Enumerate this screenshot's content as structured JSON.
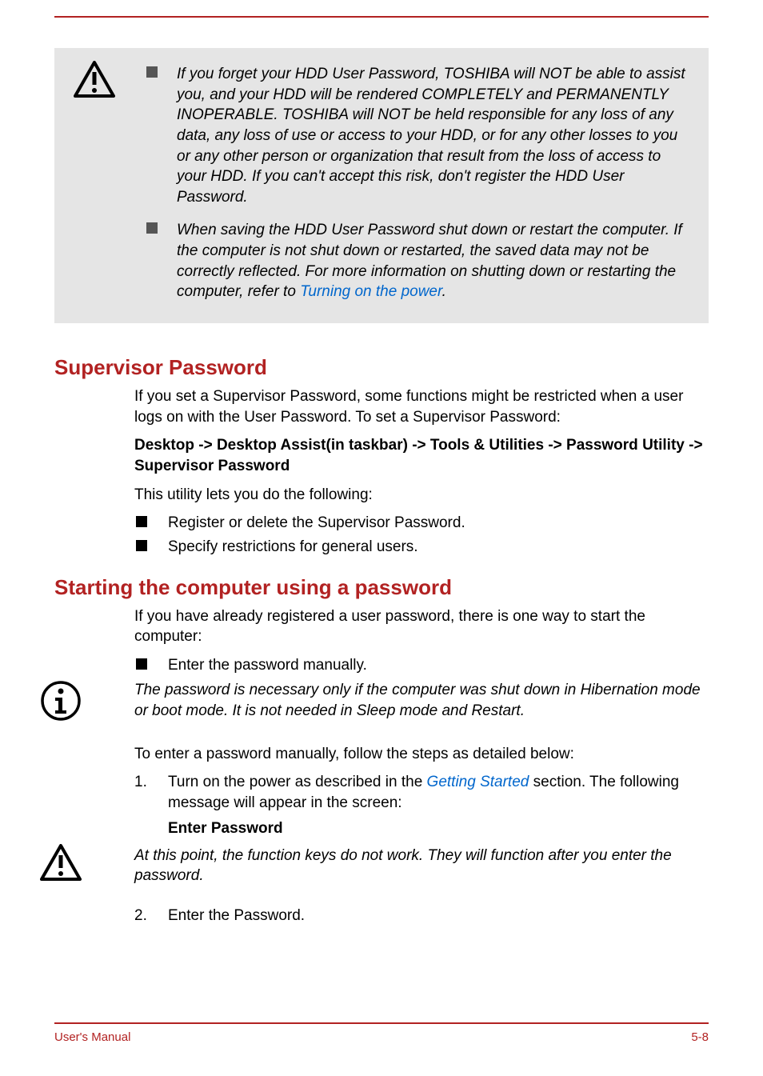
{
  "warning": {
    "items": [
      {
        "text": "If you forget your HDD User Password, TOSHIBA will NOT be able to assist you, and your HDD will be rendered COMPLETELY and PERMANENTLY INOPERABLE. TOSHIBA will NOT be held responsible for any loss of any data, any loss of use or access to your HDD, or for any other losses to you or any other person or organization that result from the loss of access to your HDD. If you can't accept this risk, don't register the HDD User Password."
      },
      {
        "text_before_link": "When saving the HDD User Password shut down or restart the computer. If the computer is not shut down or restarted, the saved data may not be correctly reflected. For more information on shutting down or restarting the computer, refer to ",
        "link": "Turning on the power",
        "text_after_link": "."
      }
    ]
  },
  "section1": {
    "heading": "Supervisor Password",
    "p1": "If you set a Supervisor Password, some functions might be restricted when a user logs on with the User Password. To set a Supervisor Password:",
    "path": "Desktop -> Desktop Assist(in taskbar) -> Tools & Utilities -> Password Utility -> Supervisor Password",
    "p2": "This utility lets you do the following:",
    "bullets": [
      "Register or delete the Supervisor Password.",
      "Specify restrictions for general users."
    ]
  },
  "section2": {
    "heading": "Starting the computer using a password",
    "p1": "If you have already registered a user password, there is one way to start the computer:",
    "bullets": [
      "Enter the password manually."
    ],
    "info_note": "The password is necessary only if the computer was shut down in Hibernation mode or boot mode. It is not needed in Sleep mode and Restart.",
    "p2": "To enter a password manually, follow the steps as detailed below:",
    "step1_before": "Turn on the power as described in the ",
    "step1_link": "Getting Started",
    "step1_after": " section. The following message will appear in the screen:",
    "enter_password": "Enter Password",
    "caution_note": "At this point, the function keys do not work. They will function after you enter the password.",
    "step2": "Enter the Password.",
    "step1_num": "1.",
    "step2_num": "2."
  },
  "footer": {
    "left": "User's Manual",
    "right": "5-8"
  }
}
